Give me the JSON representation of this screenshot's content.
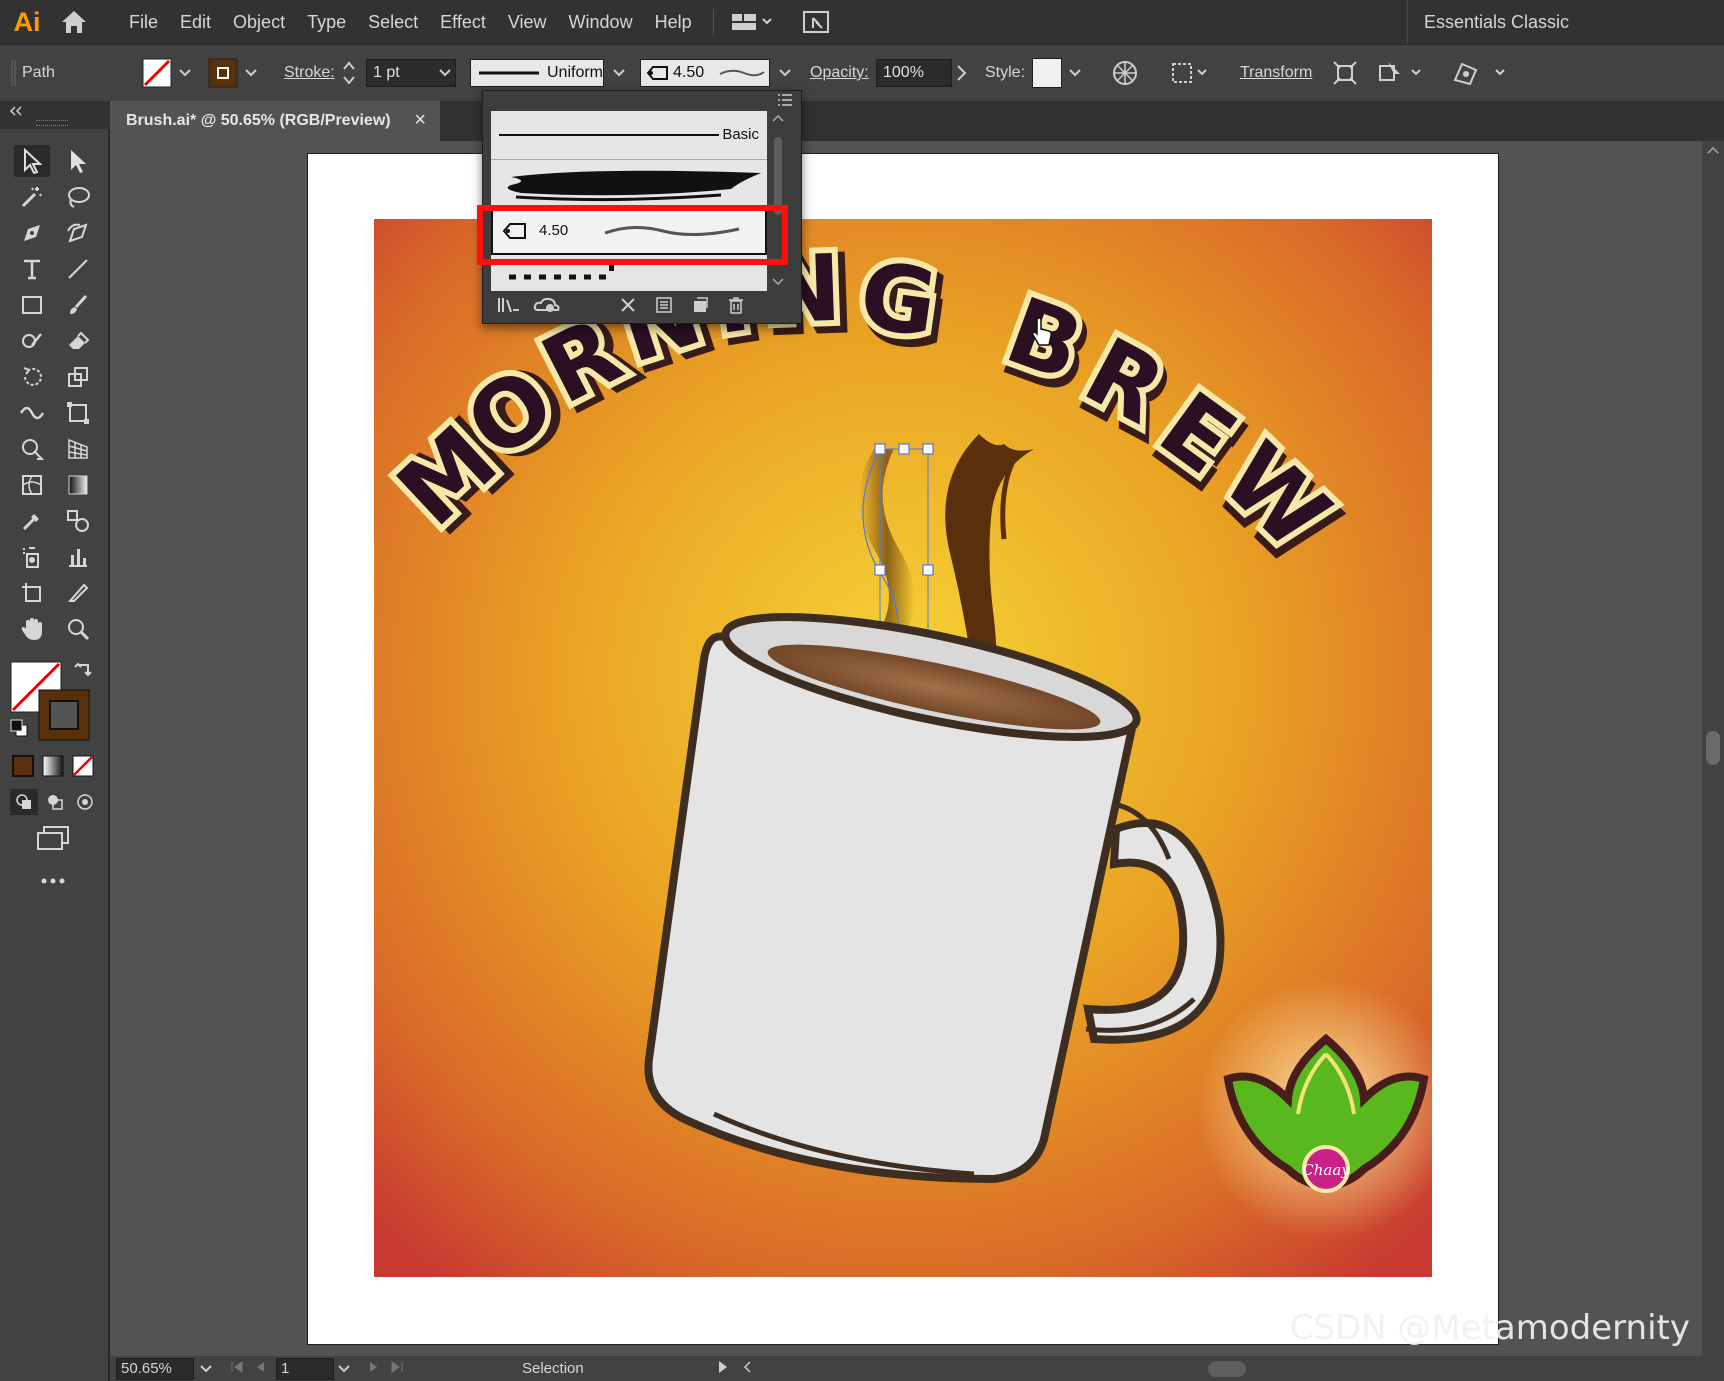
{
  "app": {
    "logo": "Ai",
    "menu": [
      "File",
      "Edit",
      "Object",
      "Type",
      "Select",
      "Effect",
      "View",
      "Window",
      "Help"
    ],
    "workspace": "Essentials Classic"
  },
  "control_bar": {
    "selection_type": "Path",
    "stroke_label": "Stroke:",
    "stroke_weight": "1 pt",
    "profile": "Uniform",
    "brush_size": "4.50",
    "opacity_label": "Opacity:",
    "opacity_value": "100%",
    "style_label": "Style:",
    "transform_label": "Transform"
  },
  "document": {
    "tab_title": "Brush.ai* @ 50.65% (RGB/Preview)",
    "close_glyph": "×"
  },
  "brush_panel": {
    "items": [
      {
        "label": "Basic",
        "kind": "basic"
      },
      {
        "label": "",
        "kind": "art-brush-ink"
      },
      {
        "label": "4.50",
        "kind": "calligraphic",
        "selected": true
      },
      {
        "label": "",
        "kind": "dotted"
      }
    ]
  },
  "artwork": {
    "headline": "MORNING BREW",
    "badge_text": "Chaay",
    "colors": {
      "bg_center": "#f6d335",
      "bg_edge": "#c83a31",
      "mug": "#e4e4e4",
      "outline": "#3e2e22",
      "coffee": "#7a4a2a",
      "text_fill": "#2b0f22",
      "text_outline": "#f6e9a8",
      "leaf": "#58b81e"
    }
  },
  "status_bar": {
    "zoom": "50.65%",
    "page": "1",
    "tool": "Selection"
  },
  "watermark": "CSDN @Metamodernity"
}
